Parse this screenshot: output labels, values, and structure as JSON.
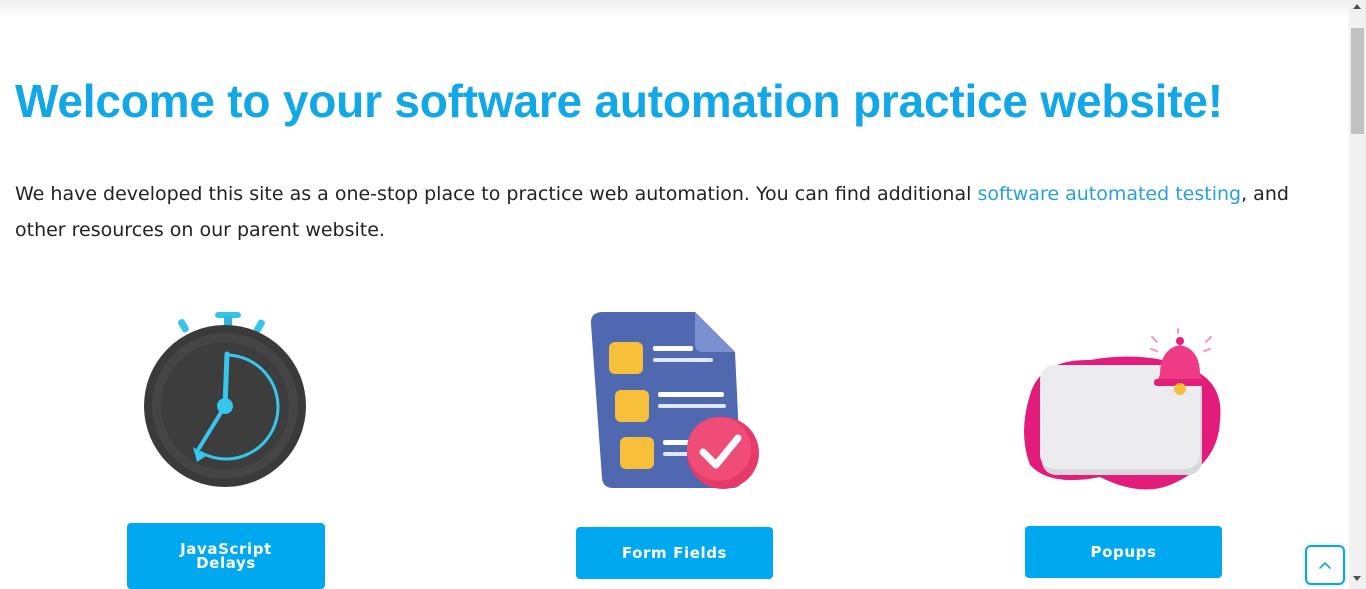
{
  "header": {
    "title": "Welcome to your software automation practice website!"
  },
  "intro": {
    "text_before": "We have developed this site as a one-stop place to practice web automation. You can find additional ",
    "link_text": "software automated testing",
    "text_after": ", and other resources on our parent website."
  },
  "cards": [
    {
      "button_label": "JavaScript Delays",
      "icon": "stopwatch-icon"
    },
    {
      "button_label": "Form Fields",
      "icon": "checklist-form-icon"
    },
    {
      "button_label": "Popups",
      "icon": "popup-bell-icon"
    }
  ],
  "colors": {
    "title": "#12a7e6",
    "button": "#00a8f0",
    "link": "#2a9fdc"
  },
  "controls": {
    "back_to_top_icon": "chevron-up-icon"
  }
}
